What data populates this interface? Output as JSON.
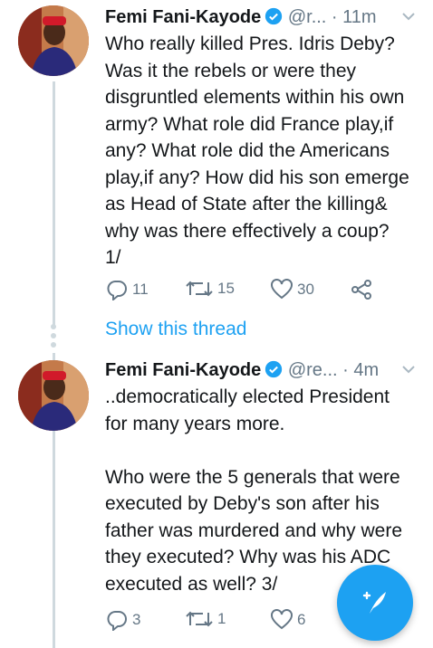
{
  "tweets": [
    {
      "author": "Femi Fani-Kayode",
      "handle": "@r...",
      "separator": "·",
      "time": "11m",
      "text": "Who really killed Pres. Idris Deby?\nWas it the rebels or were they\ndisgruntled elements within his own\narmy? What role did France play,if\nany? What role did the Americans\nplay,if any? How did his son emerge\nas Head of State after the killing&\nwhy was there effectively a coup?\n1/",
      "replies": "11",
      "retweets": "15",
      "likes": "30"
    },
    {
      "author": "Femi Fani-Kayode",
      "handle": "@re...",
      "separator": "·",
      "time": "4m",
      "text": "..democratically elected President\nfor many years more.\n\nWho were the 5 generals that were\nexecuted by Deby's son after his\nfather was murdered and why were\nthey executed? Why was his ADC\nexecuted as well? 3/",
      "replies": "3",
      "retweets": "1",
      "likes": "6"
    }
  ],
  "show_thread": "Show this thread",
  "colors": {
    "accent": "#1da1f2",
    "muted": "#657786",
    "text": "#14171a"
  }
}
